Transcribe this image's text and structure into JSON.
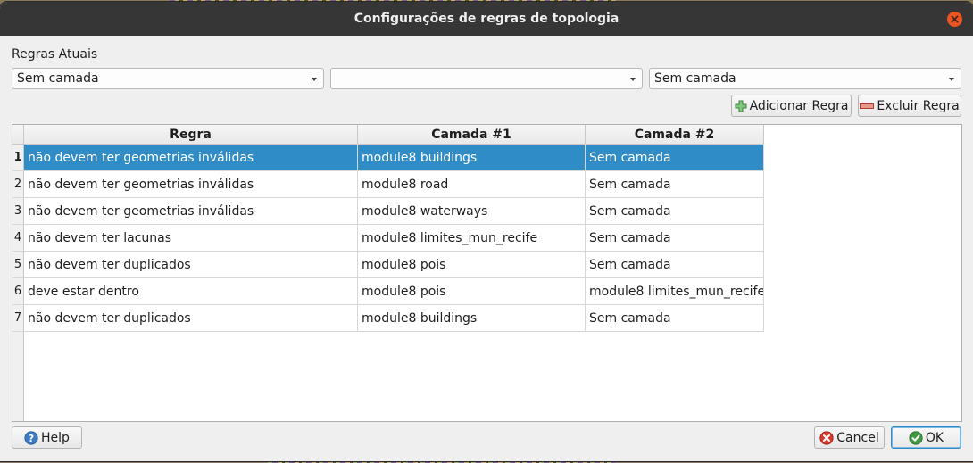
{
  "dialog": {
    "title": "Configurações de regras de topologia",
    "close_icon": "close-icon"
  },
  "rules_section": {
    "label": "Regras Atuais"
  },
  "selectors": {
    "rule_layer_1": "Sem camada",
    "rule_type": "",
    "rule_layer_2": "Sem camada"
  },
  "actions": {
    "add_rule": "Adicionar Regra",
    "add_rule_icon": "plus-icon",
    "delete_rule": "Excluir Regra",
    "delete_rule_icon": "minus-icon"
  },
  "table": {
    "columns": [
      "Regra",
      "Camada #1",
      "Camada #2"
    ],
    "selected_row": 1,
    "rows": [
      {
        "num": "1",
        "rule": "não devem ter geometrias inválidas",
        "layer1": "module8 buildings",
        "layer2": "Sem camada"
      },
      {
        "num": "2",
        "rule": "não devem ter geometrias inválidas",
        "layer1": "module8 road",
        "layer2": "Sem camada"
      },
      {
        "num": "3",
        "rule": "não devem ter geometrias inválidas",
        "layer1": "module8 waterways",
        "layer2": "Sem camada"
      },
      {
        "num": "4",
        "rule": "não devem ter lacunas",
        "layer1": "module8 limites_mun_recife",
        "layer2": "Sem camada"
      },
      {
        "num": "5",
        "rule": "não devem ter duplicados",
        "layer1": "module8 pois",
        "layer2": "Sem camada"
      },
      {
        "num": "6",
        "rule": "deve estar dentro",
        "layer1": "module8 pois",
        "layer2": "module8 limites_mun_recife"
      },
      {
        "num": "7",
        "rule": "não devem ter duplicados",
        "layer1": "module8 buildings",
        "layer2": "Sem camada"
      }
    ]
  },
  "footer": {
    "help": "Help",
    "help_icon": "help-icon",
    "cancel": "Cancel",
    "cancel_icon": "cancel-icon",
    "ok": "OK",
    "ok_icon": "check-icon"
  },
  "colors": {
    "titlebar": "#363636",
    "close_button": "#e95420",
    "selection": "#308cc6",
    "ok_border": "#308cc6"
  }
}
